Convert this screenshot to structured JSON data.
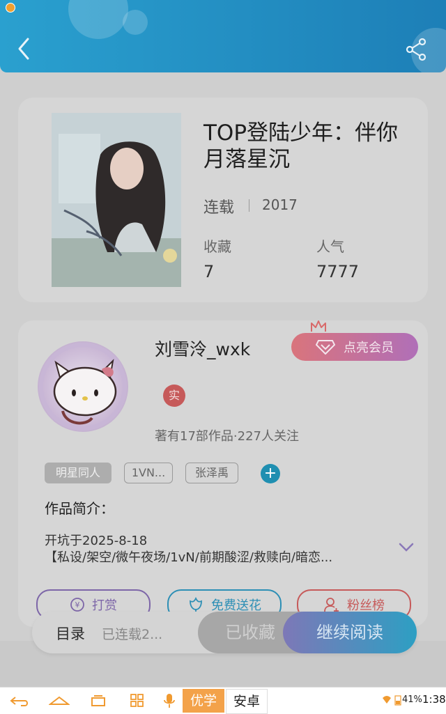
{
  "book": {
    "title": "TOP登陆少年：伴你月落星沉",
    "status": "连载",
    "year": "2017",
    "favorites_label": "收藏",
    "favorites_value": "7",
    "popularity_label": "人气",
    "popularity_value": "7777"
  },
  "author": {
    "name": "刘雪泠_wxk",
    "vip_label": "点亮会员",
    "real_badge": "实",
    "meta": "著有17部作品·227人关注",
    "tags": [
      "明星同人",
      "1VN...",
      "张泽禹"
    ],
    "tag_add": "+"
  },
  "intro": {
    "label": "作品简介：",
    "line1": "开坑于2025-8-18",
    "line2": "【私设/架空/微午夜场/1vN/前期酸涩/救赎向/暗恋..."
  },
  "actions": {
    "tip": "打赏",
    "flower": "免费送花",
    "fans": "粉丝榜"
  },
  "bottom": {
    "toc": "目录",
    "toc_progress": "已连载2...",
    "collected": "已收藏",
    "read": "继续阅读"
  },
  "system": {
    "ime_primary": "优学",
    "ime_secondary": "安卓",
    "battery": "41%",
    "time": "1:38"
  },
  "colors": {
    "header": "#2aa0cf",
    "accent": "#1f8fb1",
    "vip": "#d9747c",
    "tip": "#7d66a8",
    "flower": "#2d8fb5",
    "fans": "#c65a5a",
    "ime_highlight": "#f3a24a"
  }
}
